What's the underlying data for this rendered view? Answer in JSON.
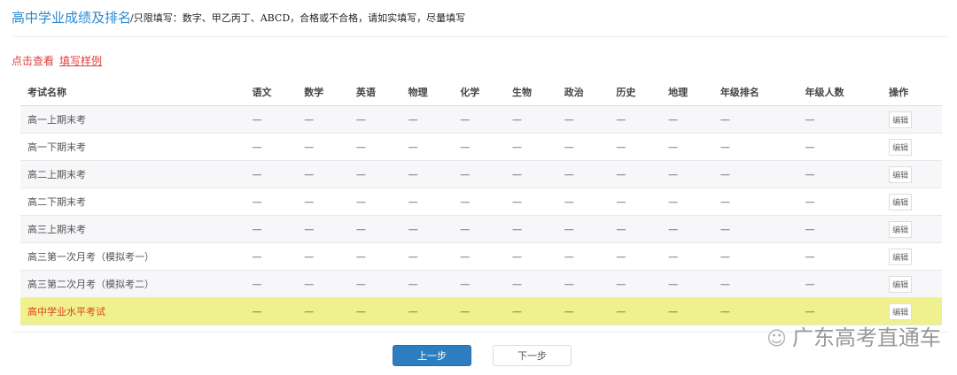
{
  "header": {
    "title": "高中学业成绩及排名",
    "note": "/只限填写：数字、甲乙丙丁、ABCD，合格或不合格，请如实填写，尽量填写"
  },
  "sample": {
    "prefix": "点击查看",
    "link": "填写样例"
  },
  "table": {
    "columns": [
      "考试名称",
      "语文",
      "数学",
      "英语",
      "物理",
      "化学",
      "生物",
      "政治",
      "历史",
      "地理",
      "年级排名",
      "年级人数",
      "操作"
    ],
    "rows": [
      {
        "name": "高一上期末考",
        "values": [
          "—",
          "—",
          "—",
          "—",
          "—",
          "—",
          "—",
          "—",
          "—",
          "—",
          "—"
        ],
        "action": "编辑"
      },
      {
        "name": "高一下期末考",
        "values": [
          "—",
          "—",
          "—",
          "—",
          "—",
          "—",
          "—",
          "—",
          "—",
          "—",
          "—"
        ],
        "action": "编辑"
      },
      {
        "name": "高二上期末考",
        "values": [
          "—",
          "—",
          "—",
          "—",
          "—",
          "—",
          "—",
          "—",
          "—",
          "—",
          "—"
        ],
        "action": "编辑"
      },
      {
        "name": "高二下期末考",
        "values": [
          "—",
          "—",
          "—",
          "—",
          "—",
          "—",
          "—",
          "—",
          "—",
          "—",
          "—"
        ],
        "action": "编辑"
      },
      {
        "name": "高三上期末考",
        "values": [
          "—",
          "—",
          "—",
          "—",
          "—",
          "—",
          "—",
          "—",
          "—",
          "—",
          "—"
        ],
        "action": "编辑"
      },
      {
        "name": "高三第一次月考（模拟考一）",
        "values": [
          "—",
          "—",
          "—",
          "—",
          "—",
          "—",
          "—",
          "—",
          "—",
          "—",
          "—"
        ],
        "action": "编辑"
      },
      {
        "name": "高三第二次月考（模拟考二）",
        "values": [
          "—",
          "—",
          "—",
          "—",
          "—",
          "—",
          "—",
          "—",
          "—",
          "—",
          "—"
        ],
        "action": "编辑"
      },
      {
        "name": "高中学业水平考试",
        "values": [
          "—",
          "—",
          "—",
          "—",
          "—",
          "—",
          "—",
          "—",
          "—",
          "—",
          "—"
        ],
        "action": "编辑",
        "highlight": true
      }
    ]
  },
  "buttons": {
    "prev": "上一步",
    "next": "下一步"
  },
  "watermark": "广东高考直通车"
}
